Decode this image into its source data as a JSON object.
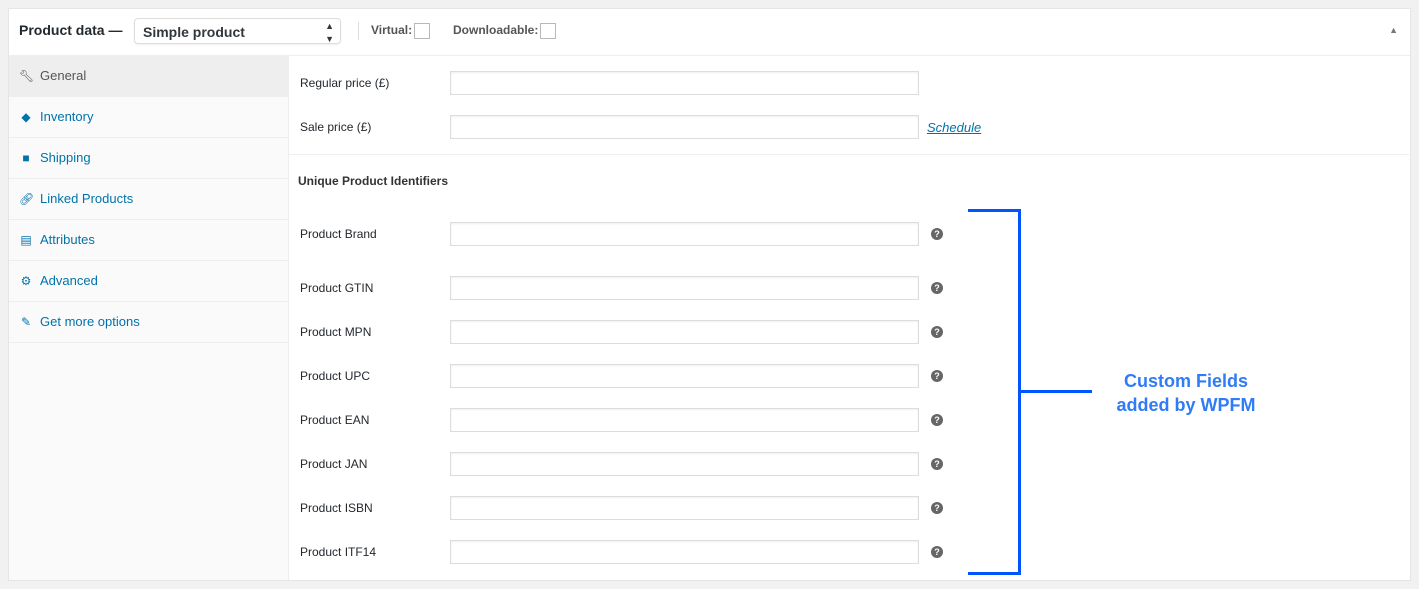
{
  "header": {
    "title": "Product data —",
    "product_type": "Simple product",
    "virtual_label": "Virtual:",
    "downloadable_label": "Downloadable:",
    "virtual_checked": false,
    "downloadable_checked": false
  },
  "sidebar": {
    "items": [
      {
        "label": "General",
        "icon": "wrench-icon",
        "active": true
      },
      {
        "label": "Inventory",
        "icon": "tag-icon"
      },
      {
        "label": "Shipping",
        "icon": "truck-icon"
      },
      {
        "label": "Linked Products",
        "icon": "link-icon"
      },
      {
        "label": "Attributes",
        "icon": "list-icon"
      },
      {
        "label": "Advanced",
        "icon": "gear-icon"
      },
      {
        "label": "Get more options",
        "icon": "plugin-icon"
      }
    ]
  },
  "pricing": {
    "regular_label": "Regular price (£)",
    "regular_value": "",
    "sale_label": "Sale price (£)",
    "sale_value": "",
    "schedule_link": "Schedule"
  },
  "identifiers": {
    "heading": "Unique Product Identifiers",
    "fields": [
      {
        "label": "Product Brand",
        "value": ""
      },
      {
        "label": "Product GTIN",
        "value": ""
      },
      {
        "label": "Product MPN",
        "value": ""
      },
      {
        "label": "Product UPC",
        "value": ""
      },
      {
        "label": "Product EAN",
        "value": ""
      },
      {
        "label": "Product JAN",
        "value": ""
      },
      {
        "label": "Product ISBN",
        "value": ""
      },
      {
        "label": "Product ITF14",
        "value": ""
      }
    ]
  },
  "annotation": {
    "line1": "Custom Fields",
    "line2": "added by WPFM",
    "color": "#0055ff"
  }
}
